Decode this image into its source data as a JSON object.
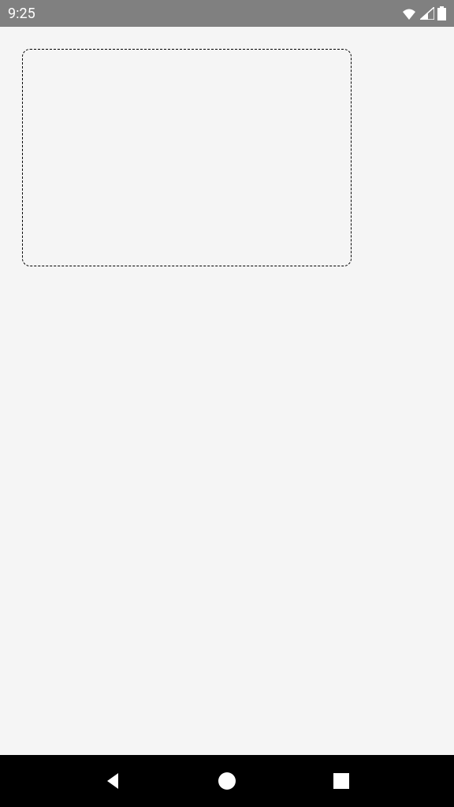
{
  "status_bar": {
    "time": "9:25"
  }
}
